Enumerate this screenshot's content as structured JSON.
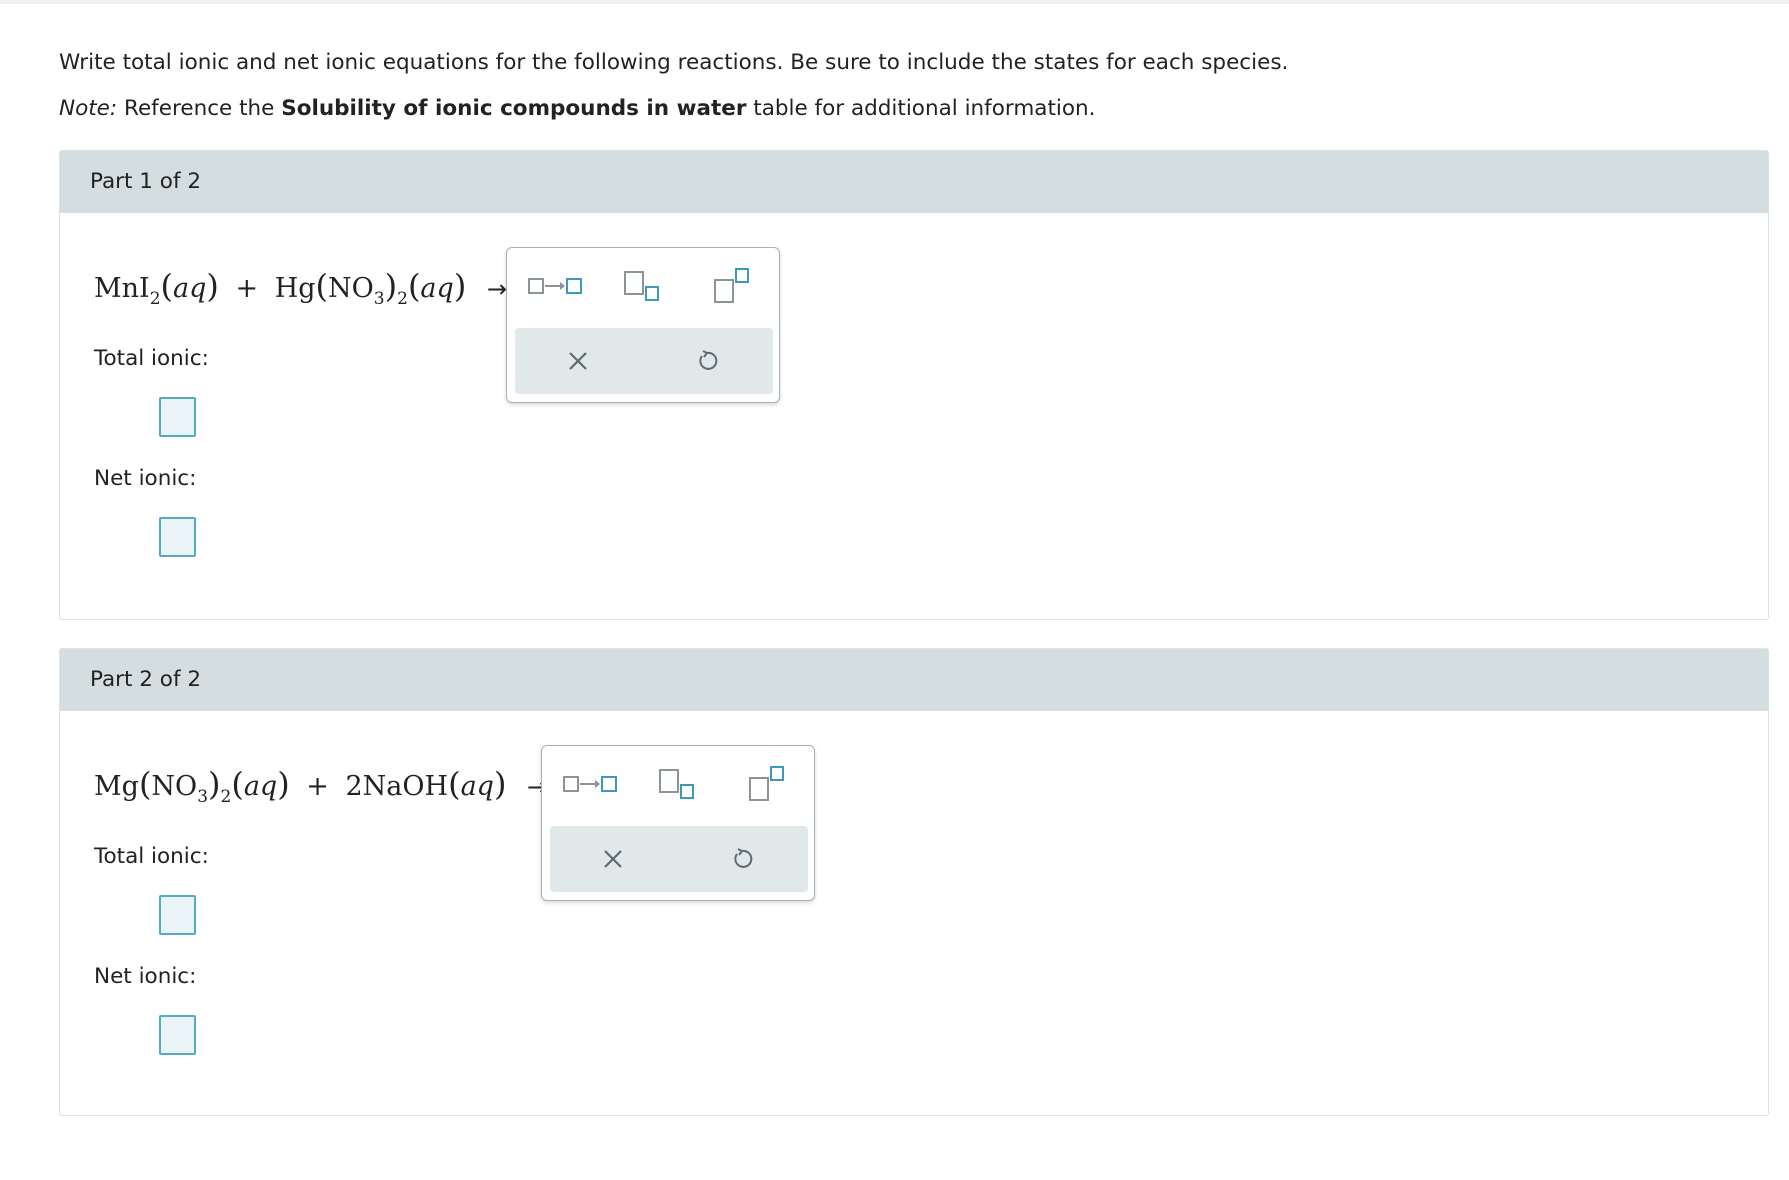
{
  "instructions": {
    "line1": "Write total ionic and net ionic equations for the following reactions. Be sure to include the states for each species.",
    "note_label": "Note:",
    "note_pre": " Reference the ",
    "note_bold": "Solubility of ionic compounds in water",
    "note_post": " table for additional information."
  },
  "parts": [
    {
      "header": "Part 1 of 2",
      "equation": {
        "r1_formula": "MnI",
        "r1_sub": "2",
        "r1_state": "aq",
        "plus": "+",
        "r2_formula": "Hg",
        "r2_inner": "NO",
        "r2_inner_sub": "3",
        "r2_outer_sub": "2",
        "r2_state": "aq",
        "arrow": "→"
      },
      "total_label": "Total ionic:",
      "net_label": "Net ionic:"
    },
    {
      "header": "Part 2 of 2",
      "equation": {
        "r1_formula": "Mg",
        "r1_inner": "NO",
        "r1_inner_sub": "3",
        "r1_outer_sub": "2",
        "r1_state": "aq",
        "plus": "+",
        "r2_formula": "2NaOH",
        "r2_state": "aq",
        "arrow": "→"
      },
      "total_label": "Total ionic:",
      "net_label": "Net ionic:"
    }
  ],
  "palette": {
    "tools": [
      "reaction-arrow-icon",
      "subscript-icon",
      "superscript-icon"
    ],
    "actions": [
      "clear-icon",
      "undo-icon"
    ],
    "accent_color": "#3a9ab8",
    "icon_color": "#8a9499"
  }
}
